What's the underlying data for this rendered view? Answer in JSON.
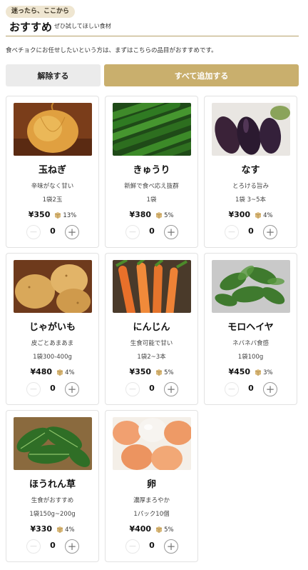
{
  "header": {
    "badge": "迷ったら、ここから",
    "title": "おすすめ",
    "subtitle": "ぜひ試してほしい食材",
    "description": "食べチョクにお任せしたいという方は、まずはこちらの品目がおすすめです。"
  },
  "actions": {
    "clear_label": "解除する",
    "add_all_label": "すべて追加する"
  },
  "colors": {
    "accent": "#c9af6d",
    "rule": "#b7a16b",
    "badge_bg": "#efe6d1"
  },
  "products": [
    {
      "name": "玉ねぎ",
      "tagline": "辛味がなく甘い",
      "amount": "1袋2玉",
      "price": "¥350",
      "rate": "13%",
      "qty": "0",
      "image": "onion-photo"
    },
    {
      "name": "きゅうり",
      "tagline": "新鮮で食べ応え抜群",
      "amount": "1袋",
      "price": "¥380",
      "rate": "5%",
      "qty": "0",
      "image": "cucumber-photo"
    },
    {
      "name": "なす",
      "tagline": "とろける旨み",
      "amount": "1袋 3~5本",
      "price": "¥300",
      "rate": "4%",
      "qty": "0",
      "image": "eggplant-photo"
    },
    {
      "name": "じゃがいも",
      "tagline": "皮ごとあまあま",
      "amount": "1袋300-400g",
      "price": "¥480",
      "rate": "4%",
      "qty": "0",
      "image": "potato-photo"
    },
    {
      "name": "にんじん",
      "tagline": "生食可能で甘い",
      "amount": "1袋2~3本",
      "price": "¥350",
      "rate": "5%",
      "qty": "0",
      "image": "carrot-photo"
    },
    {
      "name": "モロヘイヤ",
      "tagline": "ネバネバ食感",
      "amount": "1袋100g",
      "price": "¥450",
      "rate": "3%",
      "qty": "0",
      "image": "molokhia-photo"
    },
    {
      "name": "ほうれん草",
      "tagline": "生食がおすすめ",
      "amount": "1袋150g~200g",
      "price": "¥330",
      "rate": "4%",
      "qty": "0",
      "image": "spinach-photo"
    },
    {
      "name": "卵",
      "tagline": "濃厚まろやか",
      "amount": "1パック10個",
      "price": "¥400",
      "rate": "5%",
      "qty": "0",
      "image": "egg-photo"
    }
  ]
}
